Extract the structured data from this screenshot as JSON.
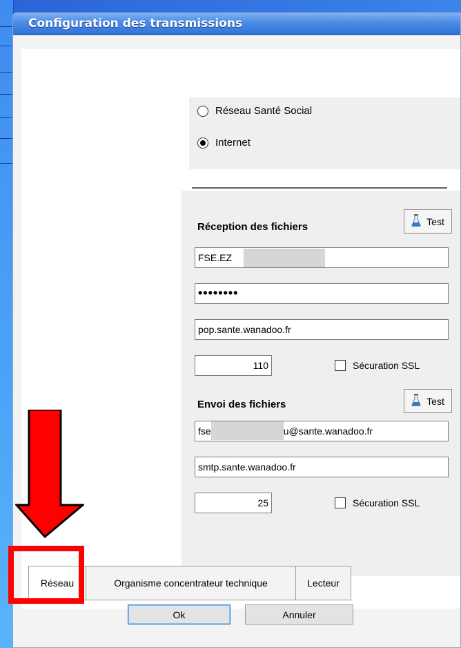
{
  "window": {
    "title": "Configuration des transmissions"
  },
  "network_choice": {
    "options": [
      {
        "label": "Réseau Santé Social",
        "selected": false
      },
      {
        "label": "Internet",
        "selected": true
      }
    ]
  },
  "reception": {
    "title": "Réception des fichiers",
    "test_label": "Test",
    "login": "FSE.EZ",
    "password": "••••••••",
    "server": "pop.sante.wanadoo.fr",
    "port": "110",
    "ssl_label": "Sécuration SSL",
    "ssl_checked": false
  },
  "sending": {
    "title": "Envoi des fichiers",
    "test_label": "Test",
    "email_prefix": "fse",
    "email_suffix": "u@sante.wanadoo.fr",
    "server": "smtp.sante.wanadoo.fr",
    "port": "25",
    "ssl_label": "Sécuration SSL",
    "ssl_checked": false
  },
  "tabs": [
    {
      "label": "Réseau",
      "active": true
    },
    {
      "label": "Organisme concentrateur technique",
      "active": false
    },
    {
      "label": "Lecteur",
      "active": false
    }
  ],
  "buttons": {
    "ok": "Ok",
    "cancel": "Annuler"
  },
  "annotation": {
    "arrow_color": "#ff0000",
    "box_color": "#ff0000"
  }
}
